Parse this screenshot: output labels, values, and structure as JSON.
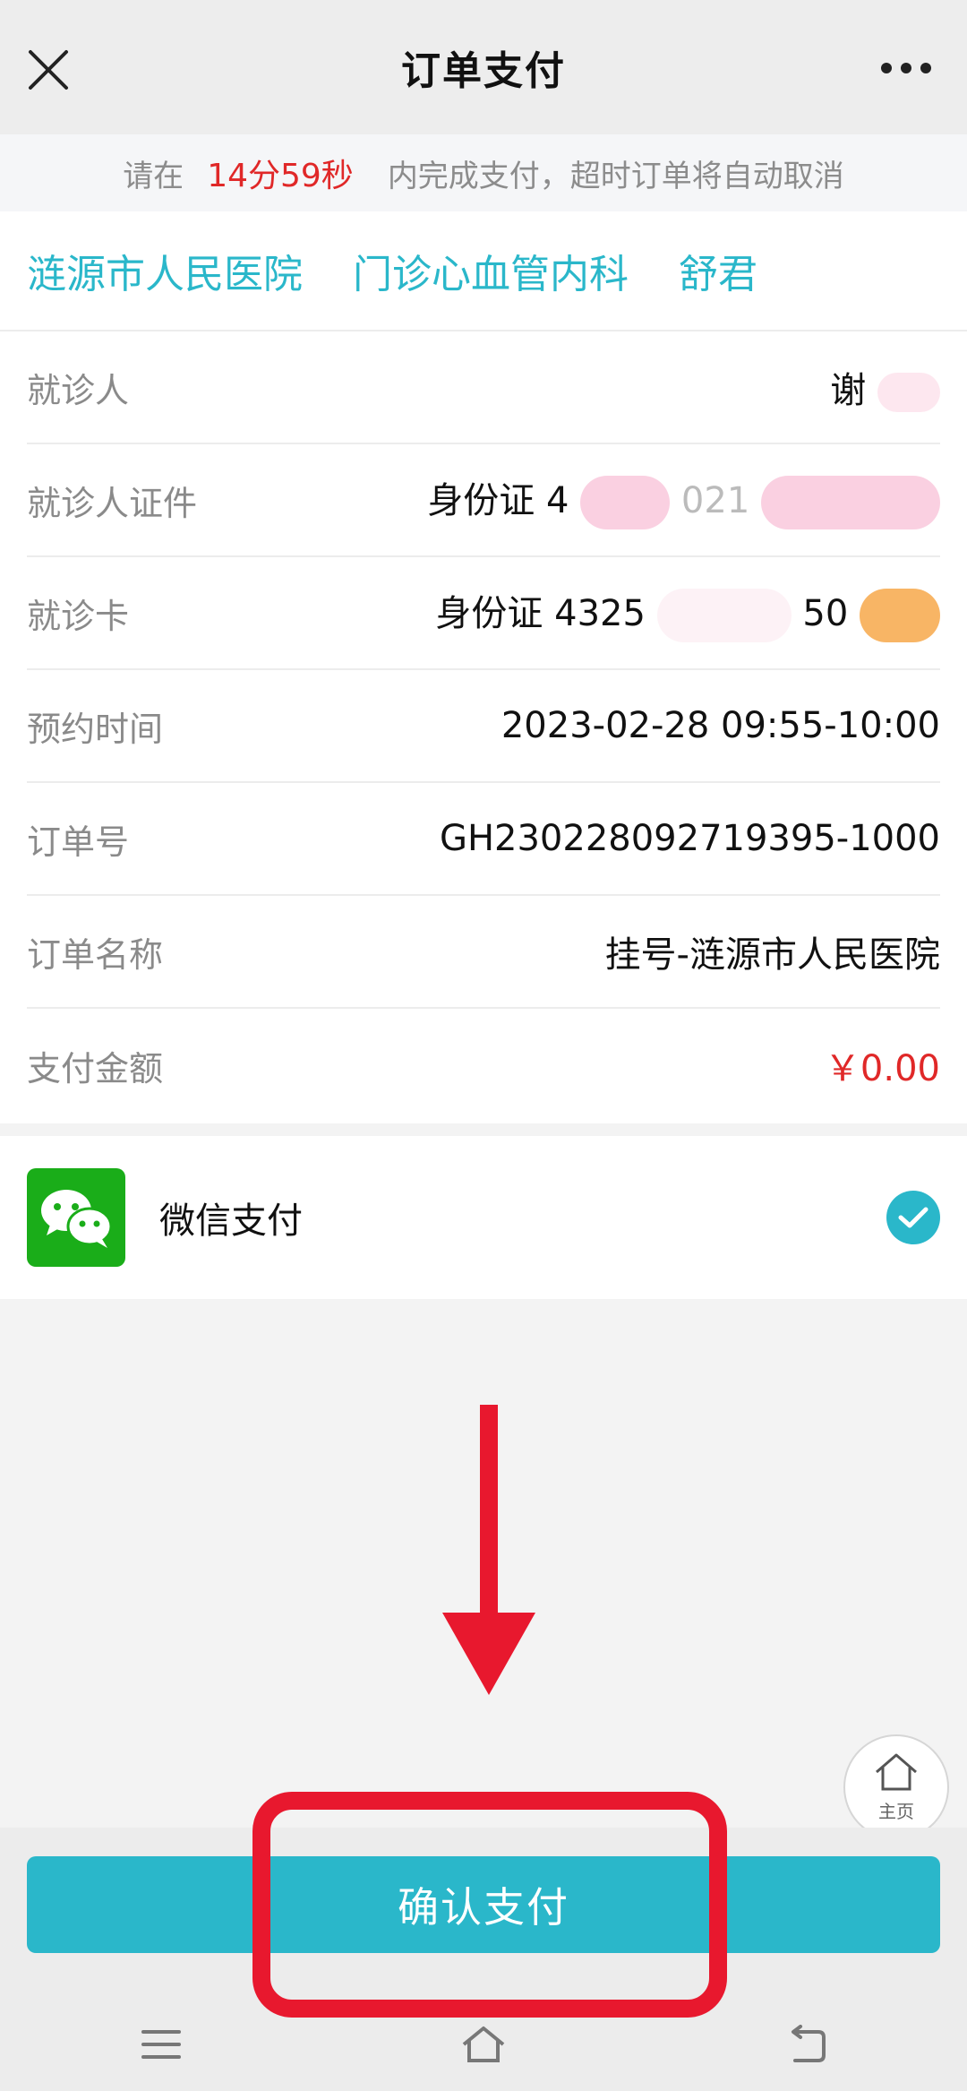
{
  "navbar": {
    "title": "订单支付"
  },
  "notice": {
    "prefix": "请在",
    "time": "14分59秒",
    "suffix": "内完成支付，超时订单将自动取消"
  },
  "hospital": {
    "name": "涟源市人民医院",
    "department": "门诊心血管内科",
    "doctor": "舒君"
  },
  "details": [
    {
      "label": "就诊人",
      "value": "谢"
    },
    {
      "label": "就诊人证件",
      "value": "身份证 4",
      "value_tail": "021"
    },
    {
      "label": "就诊卡",
      "value": "身份证 4325",
      "value_tail": "50"
    },
    {
      "label": "预约时间",
      "value": "2023-02-28 09:55-10:00"
    },
    {
      "label": "订单号",
      "value": "GH230228092719395-1000"
    },
    {
      "label": "订单名称",
      "value": "挂号-涟源市人民医院"
    },
    {
      "label": "支付金额",
      "value": "￥0.00"
    }
  ],
  "payment": {
    "method": "微信支付",
    "selected": true
  },
  "home_button": {
    "label": "主页"
  },
  "confirm_button": {
    "label": "确认支付"
  },
  "colors": {
    "accent": "#2ab7ca",
    "price_red": "#e02828",
    "annotation_red": "#e8182e",
    "wechat_green": "#1aad19"
  },
  "icons": [
    "close-icon",
    "more-icon",
    "wechat-icon",
    "check-icon",
    "home-icon",
    "menu-icon",
    "home-nav-icon",
    "back-icon"
  ]
}
